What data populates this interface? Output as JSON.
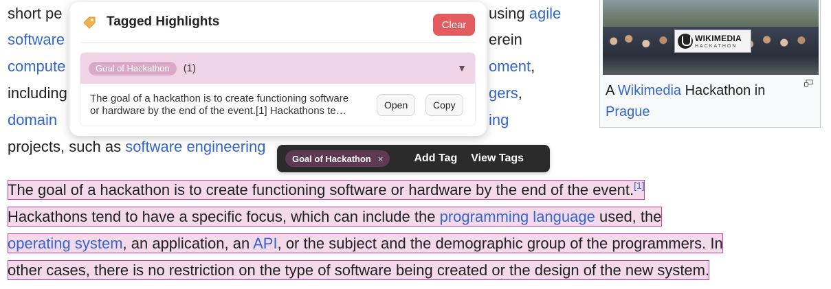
{
  "article": {
    "line1": {
      "pre": "short pe",
      "mid": "using ",
      "link": "agile"
    },
    "line2": {
      "link": "software",
      "mid": "erein"
    },
    "line3": {
      "link": "compute",
      "link2": "oment",
      "post": ","
    },
    "line4": {
      "pre": "including",
      "link": "gers",
      "post": ","
    },
    "line5": {
      "link": "domain",
      "link2": "ing"
    },
    "line6": {
      "pre": "projects, such as ",
      "link": "software engineering"
    }
  },
  "infobox": {
    "banner_title": "WIKIMEDIA",
    "banner_sub": "HACKATHON",
    "caption_pre": "A ",
    "caption_link1": "Wikimedia",
    "caption_mid": " Hackathon in",
    "caption_link2": "Prague"
  },
  "highlight": {
    "p1_text": "The goal of a hackathon is to create functioning software or hardware by the end of the event.",
    "p1_ref": "[1]",
    "p2_pre": "Hackathons tend to have a specific focus, which can include the ",
    "p2_link": "programming language",
    "p2_post": " used, the",
    "p3_link1": "operating system",
    "p3_mid1": ", an application, an ",
    "p3_link2": "API",
    "p3_post": ", or the subject and the demographic group of the programmers. In",
    "p4_text": "other cases, there is no restriction on the type of software being created or the design of the new system."
  },
  "popup": {
    "title": "Tagged Highlights",
    "clear_label": "Clear",
    "group": {
      "tag": "Goal of Hackathon",
      "count": "(1)",
      "caret": "▼",
      "item_line1": "The goal of a hackathon is to create functioning software",
      "item_line2": "or hardware by the end of the event.[1] Hackathons te…",
      "open_label": "Open",
      "copy_label": "Copy"
    }
  },
  "toolbar": {
    "chip_label": "Goal of Hackathon",
    "chip_close": "×",
    "add_tag_label": "Add Tag",
    "view_tags_label": "View Tags"
  },
  "colors": {
    "highlight_bg": "#f3d9e9",
    "highlight_border": "#c83c9c",
    "clear_button": "#e45b5f",
    "link": "#3366cc",
    "toolbar_bg": "#2b2b2b"
  },
  "icons": {
    "popup_title_icon": "tag-icon",
    "expand_icon": "chevron-down-icon",
    "image_enlarge": "magnify-icon"
  }
}
